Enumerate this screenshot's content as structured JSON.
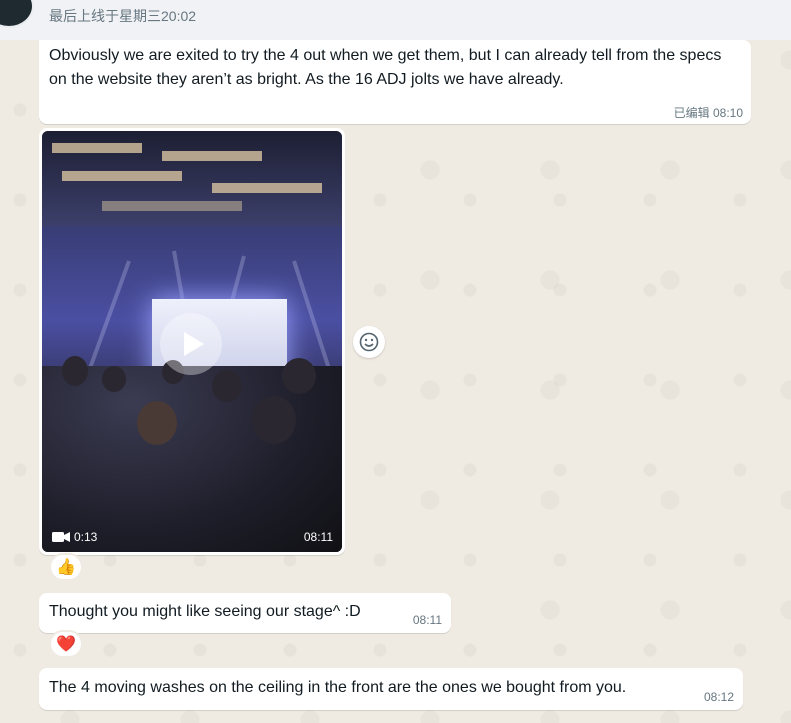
{
  "header": {
    "last_seen": "最后上线于星期三20:02"
  },
  "messages": [
    {
      "text": "Obviously we are exited to try the 4 out when we get them, but I can already tell from the specs on the website they aren’t as bright. As the 16 ADJ jolts we have already.",
      "edited_label": "已编辑",
      "time": "08:10"
    },
    {
      "type": "video",
      "duration": "0:13",
      "time": "08:11",
      "reaction": "👍"
    },
    {
      "text": "Thought you might like seeing our stage^ :D",
      "time": "08:11",
      "reaction": "❤️"
    },
    {
      "text": "The 4 moving washes on the ceiling in the front are the ones we bought from you.",
      "time": "08:12"
    }
  ],
  "colors": {
    "chat_background": "#efeae2",
    "bubble": "#ffffff",
    "meta_text": "#667781"
  },
  "icons": [
    "play-icon",
    "video-camera-icon",
    "smiley-icon"
  ]
}
